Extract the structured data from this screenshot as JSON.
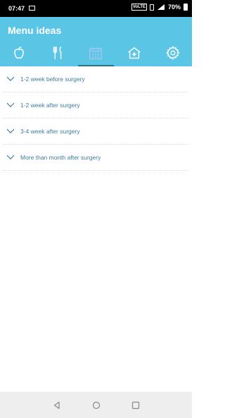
{
  "status_bar": {
    "time": "07:47",
    "volte": "VoLTE",
    "battery": "70%"
  },
  "header": {
    "title": "Menu ideas",
    "background": "#5bc5e6",
    "tabs": [
      {
        "icon": "apple-icon",
        "active": false
      },
      {
        "icon": "fork-knife-icon",
        "active": false
      },
      {
        "icon": "calendar-icon",
        "active": true
      },
      {
        "icon": "hospital-icon",
        "active": false
      },
      {
        "icon": "gear-icon",
        "active": false
      }
    ]
  },
  "menu": {
    "items": [
      {
        "label": "1-2 week before surgery"
      },
      {
        "label": "1-2 week after surgery"
      },
      {
        "label": "3-4 week after surgery"
      },
      {
        "label": "More than month after surgery"
      }
    ]
  },
  "nav": {
    "buttons": [
      "back-icon",
      "home-icon",
      "recents-icon"
    ]
  }
}
